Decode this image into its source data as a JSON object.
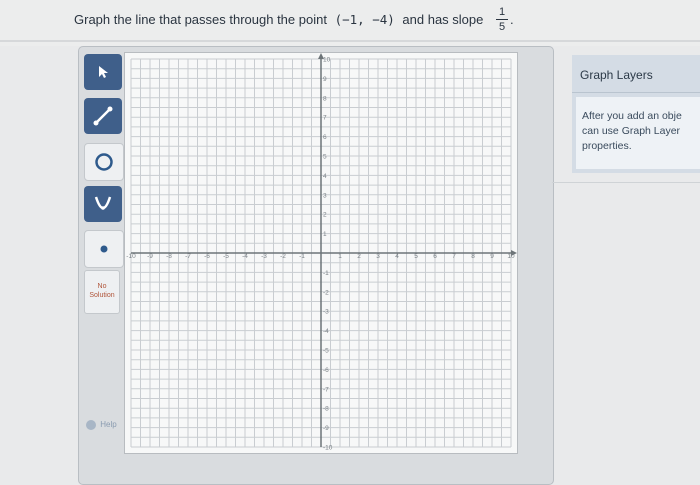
{
  "question": {
    "prefix": "Graph the line that passes through the point",
    "point": "(−1, −4)",
    "middle": "and has slope",
    "slope_numerator": "1",
    "slope_denominator": "5",
    "end": "."
  },
  "toolbar": {
    "tools": [
      {
        "icon": "arrow-pointer-icon"
      },
      {
        "icon": "line-segment-icon"
      },
      {
        "icon": "circle-icon"
      },
      {
        "icon": "parabola-icon"
      },
      {
        "icon": "point-icon"
      }
    ],
    "no_solution_line1": "No",
    "no_solution_line2": "Solution",
    "help_label": "Help"
  },
  "graph": {
    "x_range": [
      -10,
      10
    ],
    "y_range": [
      -10,
      10
    ],
    "grid": true,
    "x_tick_labels": [
      "-10",
      "-9",
      "-8",
      "-7",
      "-6",
      "-5",
      "-4",
      "-3",
      "-2",
      "-1",
      "1",
      "2",
      "3",
      "4",
      "5",
      "6",
      "7",
      "8",
      "9",
      "10"
    ],
    "y_tick_labels": [
      "10",
      "9",
      "8",
      "7",
      "6",
      "5",
      "4",
      "3",
      "2",
      "1",
      "-1",
      "-2",
      "-3",
      "-4",
      "-5",
      "-6",
      "-7",
      "-8",
      "-9",
      "-10"
    ]
  },
  "side_panel": {
    "title": "Graph Layers",
    "line1": "After you add an obje",
    "line2": "can use Graph Layer",
    "line3": "properties."
  },
  "colors": {
    "accent": "#3f5f8a",
    "grid_line": "#c9cdd1",
    "axis": "#6d7478"
  }
}
